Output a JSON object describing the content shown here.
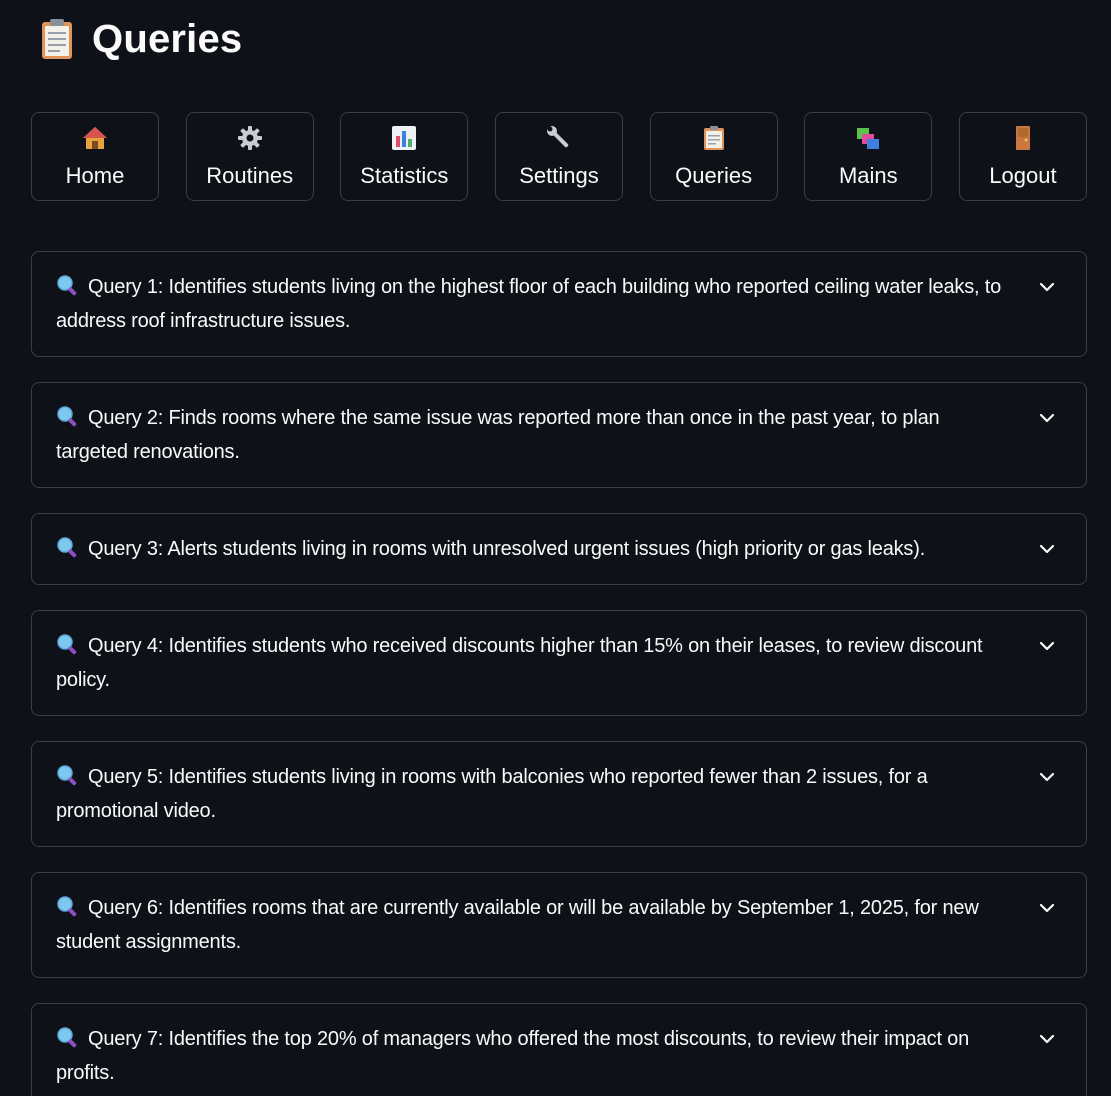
{
  "header": {
    "icon": "clipboard-icon",
    "title": "Queries"
  },
  "nav": [
    {
      "label": "Home",
      "icon": "house-icon"
    },
    {
      "label": "Routines",
      "icon": "gear-icon"
    },
    {
      "label": "Statistics",
      "icon": "bar-chart-icon"
    },
    {
      "label": "Settings",
      "icon": "wrench-icon"
    },
    {
      "label": "Queries",
      "icon": "clipboard-icon"
    },
    {
      "label": "Mains",
      "icon": "books-icon"
    },
    {
      "label": "Logout",
      "icon": "door-icon"
    }
  ],
  "queries": [
    {
      "label": "Query 1: Identifies students living on the highest floor of each building who reported ceiling water leaks, to address roof infrastructure issues."
    },
    {
      "label": "Query 2: Finds rooms where the same issue was reported more than once in the past year, to plan targeted renovations."
    },
    {
      "label": "Query 3: Alerts students living in rooms with unresolved urgent issues (high priority or gas leaks)."
    },
    {
      "label": "Query 4: Identifies students who received discounts higher than 15% on their leases, to review discount policy."
    },
    {
      "label": "Query 5: Identifies students living in rooms with balconies who reported fewer than 2 issues, for a promotional video."
    },
    {
      "label": "Query 6: Identifies rooms that are currently available or will be available by September 1, 2025, for new student assignments."
    },
    {
      "label": "Query 7: Identifies the top 20% of managers who offered the most discounts, to review their impact on profits."
    }
  ],
  "colors": {
    "background": "#0e1117",
    "border": "#3a3d45",
    "text": "#fafafa"
  }
}
